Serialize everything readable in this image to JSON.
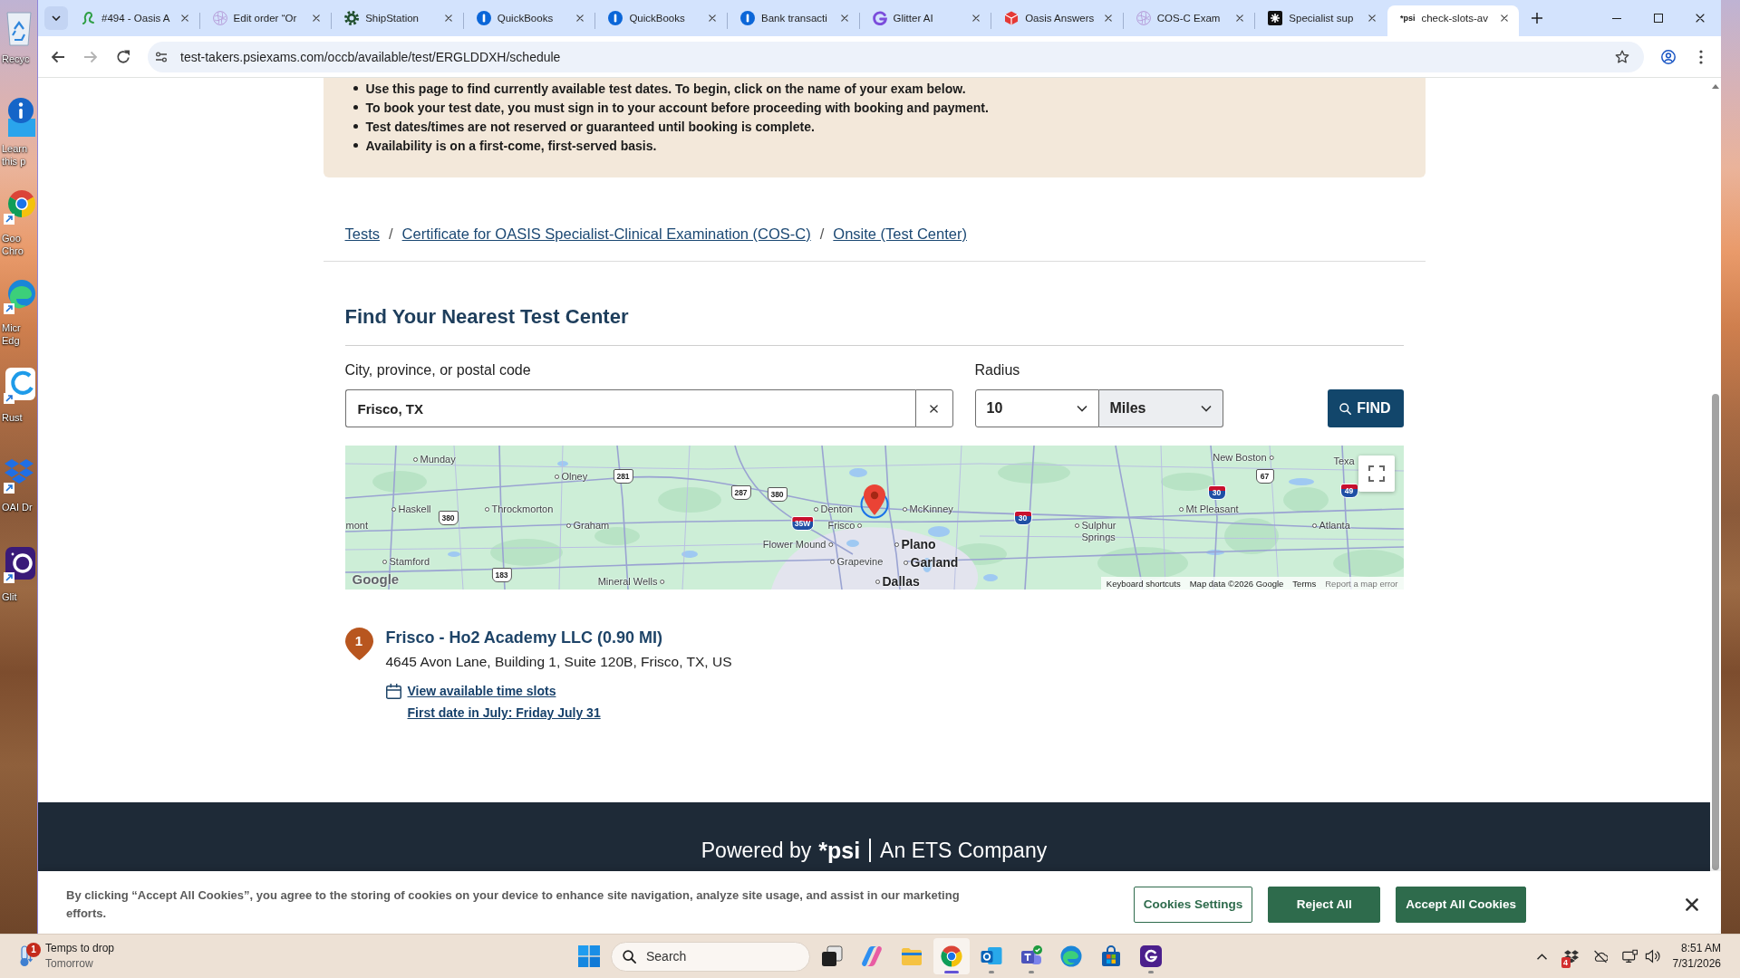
{
  "desktop": {
    "icons": [
      {
        "label": "Recyc"
      },
      {
        "label": "Learn this p"
      },
      {
        "label": "Goo Chro"
      },
      {
        "label": "Micr Edg"
      },
      {
        "label": "Rust"
      },
      {
        "label": "OAI Dr"
      },
      {
        "label": "Glit"
      }
    ]
  },
  "browser": {
    "tabs": [
      {
        "title": "#494 - Oasis A",
        "selected": false
      },
      {
        "title": "Edit order “Or",
        "selected": false
      },
      {
        "title": "ShipStation",
        "selected": false
      },
      {
        "title": "QuickBooks",
        "selected": false
      },
      {
        "title": "QuickBooks",
        "selected": false
      },
      {
        "title": "Bank transacti",
        "selected": false
      },
      {
        "title": "Glitter AI",
        "selected": false
      },
      {
        "title": "Oasis Answers",
        "selected": false
      },
      {
        "title": "COS-C Exam",
        "selected": false
      },
      {
        "title": "Specialist sup",
        "selected": false
      },
      {
        "title": "check-slots-av",
        "selected": true,
        "icon_text": "*psi"
      }
    ],
    "back": {
      "disabled": false
    },
    "forward": {
      "disabled": true
    },
    "url": "test-takers.psiexams.com/occb/available/test/ERGLDDXH/schedule"
  },
  "page": {
    "notice": [
      "Use this page to find currently available test dates. To begin, click on the name of your exam below.",
      "To book your test date, you must sign in to your account before proceeding with booking and payment.",
      "Test dates/times are not reserved or guaranteed until booking is complete.",
      "Availability is on a first-come, first-served basis."
    ],
    "breadcrumbs": [
      {
        "kind": "link",
        "text": "Tests"
      },
      {
        "kind": "separator",
        "text": "/"
      },
      {
        "kind": "link",
        "text": "Certificate for OASIS Specialist-Clinical Examination (COS-C)"
      },
      {
        "kind": "separator",
        "text": "/"
      },
      {
        "kind": "link",
        "text": "Onsite (Test Center)"
      }
    ],
    "heading": "Find Your Nearest Test Center",
    "location": {
      "label": "City, province, or postal code",
      "value": "Frisco, TX"
    },
    "radius": {
      "label": "Radius",
      "distance": "10",
      "unit": "Miles"
    },
    "find_button": "FIND",
    "map": {
      "places": [
        {
          "name": "Munday",
          "kind": "town"
        },
        {
          "name": "New Boston",
          "kind": "town"
        },
        {
          "name": "Texa",
          "kind": "town"
        },
        {
          "name": "Olney",
          "kind": "town"
        },
        {
          "name": "Haskell",
          "kind": "town"
        },
        {
          "name": "Throckmorton",
          "kind": "town"
        },
        {
          "name": "Denton",
          "kind": "town"
        },
        {
          "name": "McKinney",
          "kind": "town"
        },
        {
          "name": "Mt Pleasant",
          "kind": "town"
        },
        {
          "name": "mont",
          "kind": "town"
        },
        {
          "name": "Graham",
          "kind": "town"
        },
        {
          "name": "Frisco",
          "kind": "town"
        },
        {
          "name": "Sulphur Springs",
          "kind": "town"
        },
        {
          "name": "Atlanta",
          "kind": "town"
        },
        {
          "name": "Flower Mound",
          "kind": "town"
        },
        {
          "name": "Plano",
          "kind": "city"
        },
        {
          "name": "Stamford",
          "kind": "town"
        },
        {
          "name": "Grapevine",
          "kind": "town"
        },
        {
          "name": "Garland",
          "kind": "city"
        },
        {
          "name": "Mineral Wells",
          "kind": "town"
        },
        {
          "name": "Dallas",
          "kind": "city"
        }
      ],
      "shields": [
        {
          "label": "281",
          "kind": "us"
        },
        {
          "label": "67",
          "kind": "us"
        },
        {
          "label": "287",
          "kind": "us"
        },
        {
          "label": "380",
          "kind": "us"
        },
        {
          "label": "30",
          "kind": "interstate"
        },
        {
          "label": "49",
          "kind": "interstate"
        },
        {
          "label": "380",
          "kind": "us"
        },
        {
          "label": "35W",
          "kind": "interstate"
        },
        {
          "label": "30",
          "kind": "interstate"
        },
        {
          "label": "183",
          "kind": "us"
        }
      ],
      "logo": "Google",
      "attribution": [
        {
          "text": "Keyboard shortcuts"
        },
        {
          "text": "Map data ©2026 Google"
        },
        {
          "text": "Terms"
        },
        {
          "text": "Report a map error"
        }
      ]
    },
    "results": [
      {
        "number": "1",
        "title": "Frisco - Ho2 Academy LLC (0.90 MI)",
        "address": "4645 Avon Lane, Building 1, Suite 120B, Frisco, TX, US",
        "link": "View available time slots",
        "first_date": "First date in July: Friday July 31"
      }
    ],
    "footer": {
      "powered_by": "Powered by",
      "logo": "*psi",
      "company": "An ETS Company"
    }
  },
  "cookie_banner": {
    "text": "By clicking “Accept All Cookies”, you agree to the storing of cookies on your device to enhance site navigation, analyze site usage, and assist in our marketing efforts.",
    "buttons": [
      {
        "kind": "outline",
        "label": "Cookies Settings"
      },
      {
        "kind": "solid",
        "label": "Reject All"
      },
      {
        "kind": "solid",
        "label": "Accept All Cookies"
      }
    ]
  },
  "taskbar": {
    "weather": {
      "badge": "1",
      "headline": "Temps to drop",
      "detail": "Tomorrow"
    },
    "search": {
      "placeholder": "Search"
    },
    "apps": [
      {
        "active": false,
        "running": false
      },
      {
        "active": false,
        "running": false
      },
      {
        "active": false,
        "running": false
      },
      {
        "active": true,
        "running": true
      },
      {
        "active": false,
        "running": true
      },
      {
        "active": false,
        "running": true
      },
      {
        "active": false,
        "running": false
      },
      {
        "active": false,
        "running": false
      },
      {
        "active": false,
        "running": true
      }
    ],
    "tray": {
      "badge": "4"
    },
    "clock": {
      "time": "8:51 AM",
      "date": "7/31/2026"
    }
  }
}
